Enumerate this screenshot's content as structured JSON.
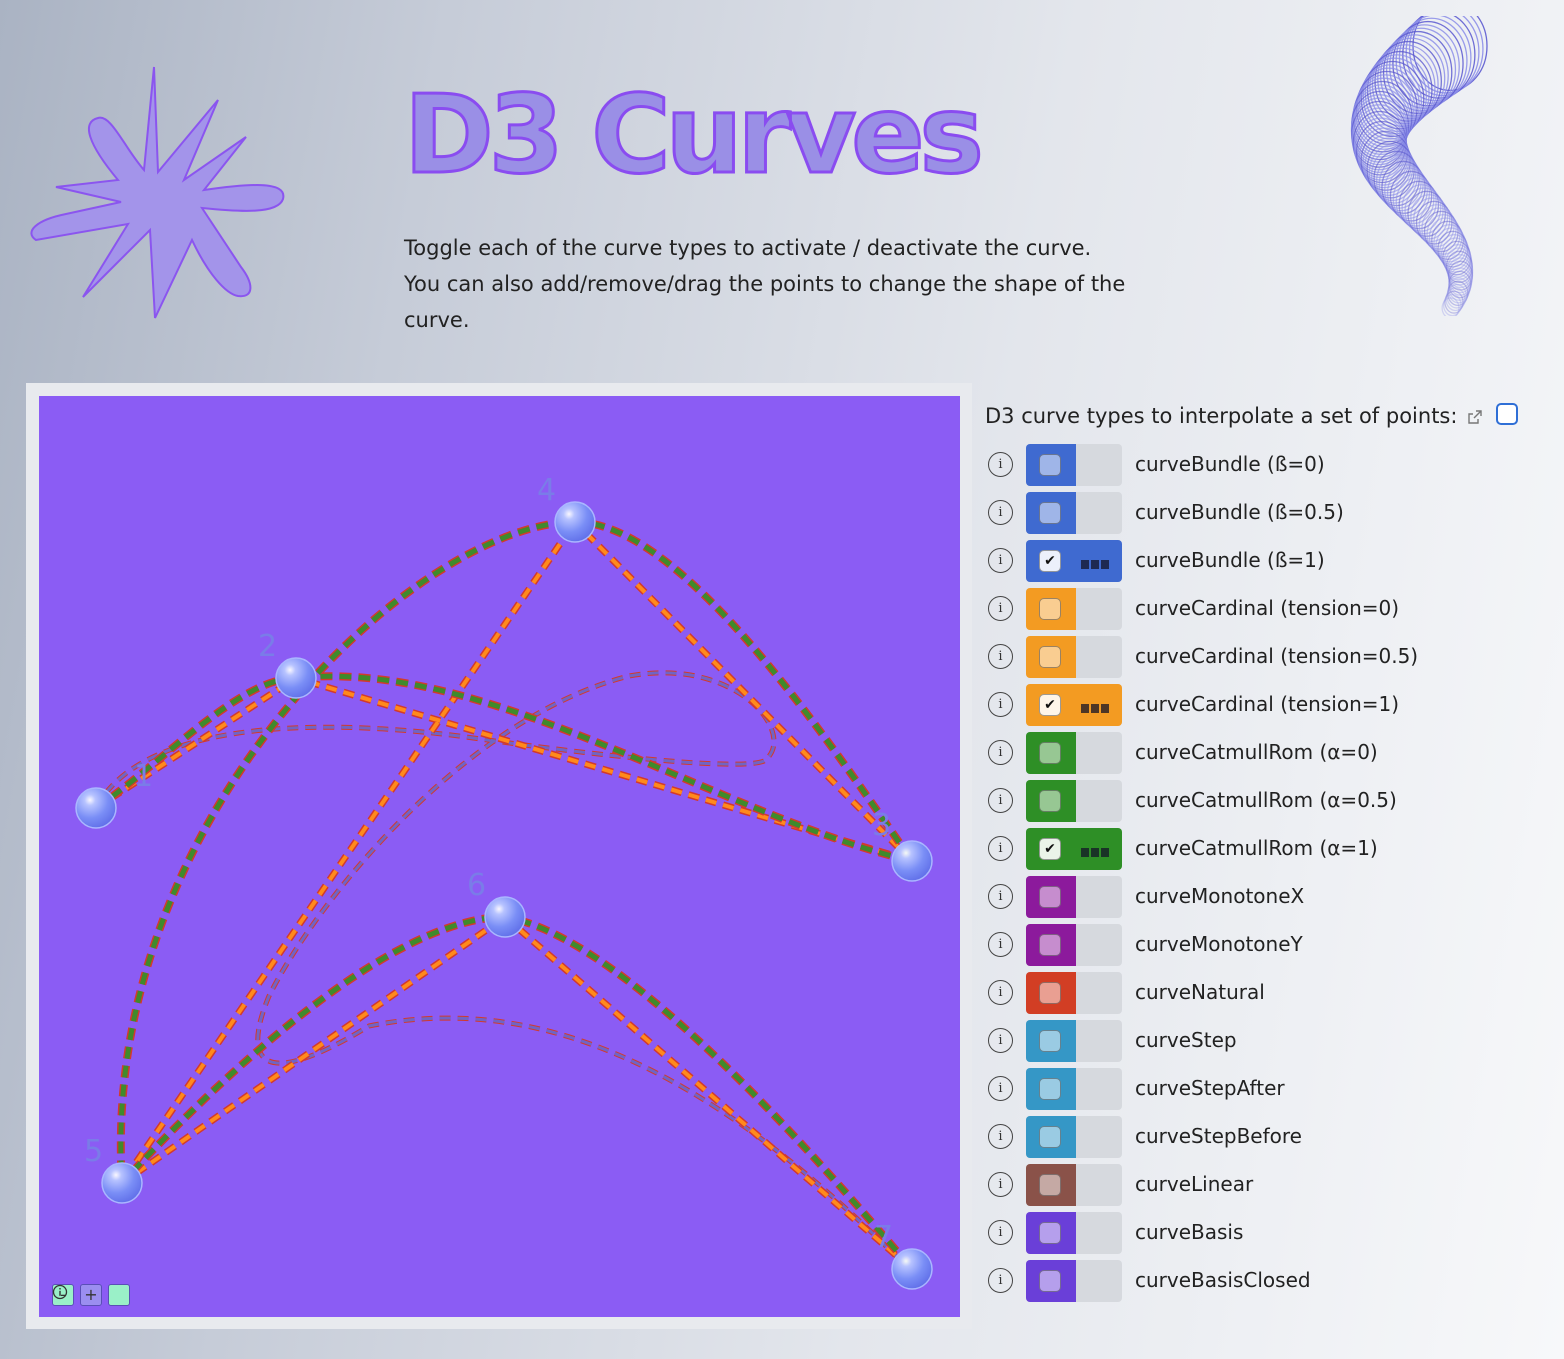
{
  "header": {
    "title": "D3 Curves",
    "intro_line1": "Toggle each of the curve types to activate / deactivate the curve.",
    "intro_line2": "You can also add/remove/drag the points to change the shape of the curve."
  },
  "canvas": {
    "background": "#8b5cf4",
    "point_labels": [
      "1",
      "2",
      "3",
      "4",
      "5",
      "6",
      "7"
    ],
    "zoom_out_label": "-",
    "zoom_in_label": "+",
    "info_label": "i"
  },
  "controls": {
    "heading": "D3 curve types to interpolate a set of points:",
    "external_link_icon": "external-link-icon",
    "select_all_checked": false,
    "info_icon_label": "i",
    "curves": [
      {
        "label": "curveBundle (ß=0)",
        "color": "#3f6ad0",
        "active": false
      },
      {
        "label": "curveBundle (ß=0.5)",
        "color": "#3f6ad0",
        "active": false
      },
      {
        "label": "curveBundle (ß=1)",
        "color": "#3f6ad0",
        "active": true
      },
      {
        "label": "curveCardinal (tension=0)",
        "color": "#f39b22",
        "active": false
      },
      {
        "label": "curveCardinal (tension=0.5)",
        "color": "#f39b22",
        "active": false
      },
      {
        "label": "curveCardinal (tension=1)",
        "color": "#f39b22",
        "active": true
      },
      {
        "label": "curveCatmullRom (α=0)",
        "color": "#2e8f26",
        "active": false
      },
      {
        "label": "curveCatmullRom (α=0.5)",
        "color": "#2e8f26",
        "active": false
      },
      {
        "label": "curveCatmullRom (α=1)",
        "color": "#2e8f26",
        "active": true
      },
      {
        "label": "curveMonotoneX",
        "color": "#8c1a9c",
        "active": false
      },
      {
        "label": "curveMonotoneY",
        "color": "#8c1a9c",
        "active": false
      },
      {
        "label": "curveNatural",
        "color": "#d23e24",
        "active": false
      },
      {
        "label": "curveStep",
        "color": "#3597c6",
        "active": false
      },
      {
        "label": "curveStepAfter",
        "color": "#3597c6",
        "active": false
      },
      {
        "label": "curveStepBefore",
        "color": "#3597c6",
        "active": false
      },
      {
        "label": "curveLinear",
        "color": "#8a5249",
        "active": false
      },
      {
        "label": "curveBasis",
        "color": "#6a3fd8",
        "active": false
      },
      {
        "label": "curveBasisClosed",
        "color": "#6a3fd8",
        "active": false
      }
    ]
  }
}
